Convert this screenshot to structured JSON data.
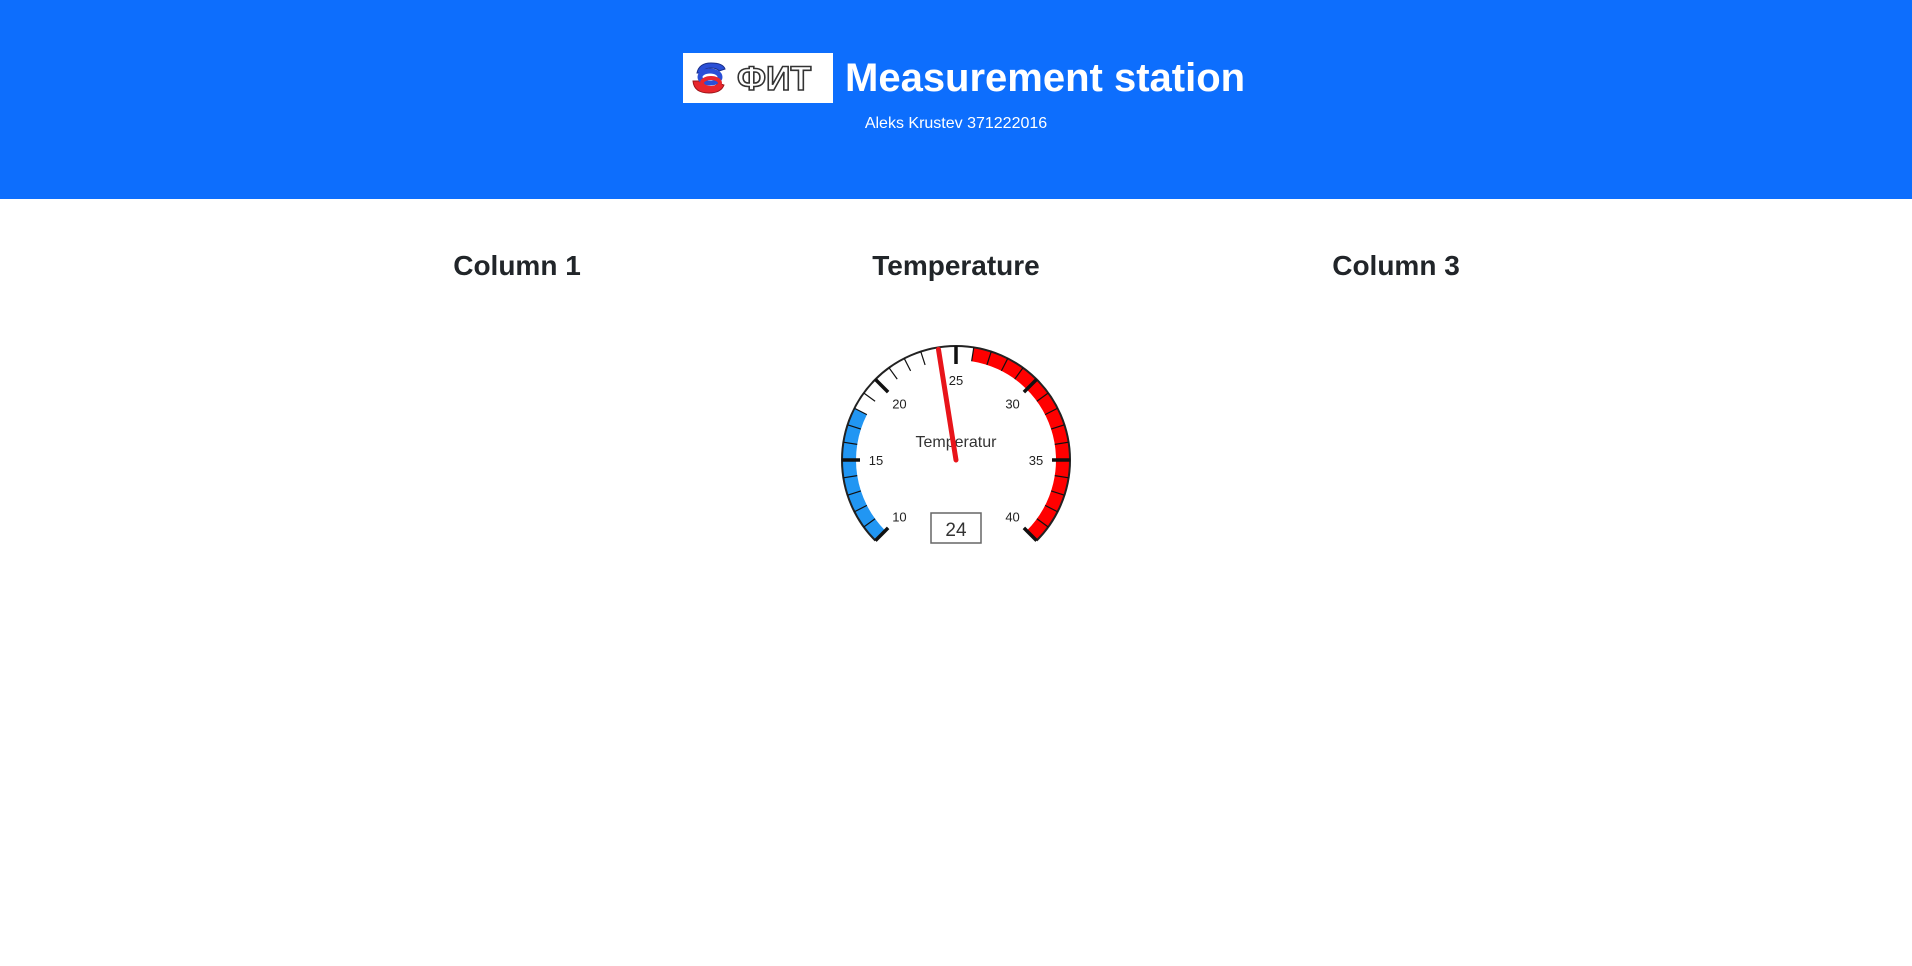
{
  "header": {
    "logo_text": "ФИТ",
    "title": "Measurement station",
    "subtitle": "Aleks Krustev 371222016",
    "background_color": "#0d6efd"
  },
  "columns": [
    {
      "heading": "Column 1"
    },
    {
      "heading": "Temperature"
    },
    {
      "heading": "Column 3"
    }
  ],
  "gauge": {
    "label": "Temperatur",
    "value": 24,
    "value_display": "24",
    "min": 10,
    "max": 40,
    "major_ticks": [
      "10",
      "15",
      "20",
      "25",
      "30",
      "35",
      "40"
    ],
    "cold_range": [
      10,
      18
    ],
    "hot_range": [
      26,
      40
    ],
    "cold_color": "#2196f3",
    "hot_color": "#ff0000",
    "needle_color": "#e8141a"
  }
}
